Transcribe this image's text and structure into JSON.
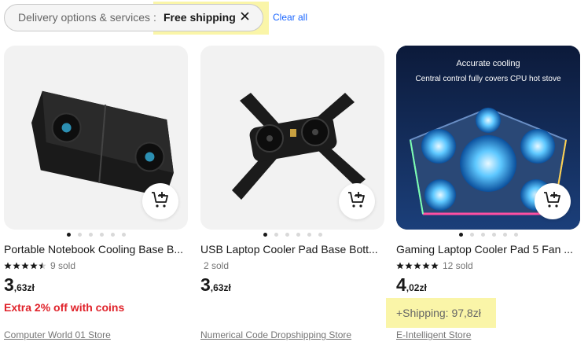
{
  "filter": {
    "label": "Delivery options & services :",
    "value": "Free shipping",
    "clear_label": "Clear all"
  },
  "products": [
    {
      "title": "Portable Notebook Cooling Base B...",
      "rating_stars": 4.5,
      "sold": "9 sold",
      "price_int": "3",
      "price_dec": ",63zł",
      "promo": "Extra 2% off with coins",
      "store": "Computer World 01 Store",
      "image_dots": 6,
      "active_dot": 0
    },
    {
      "title": "USB Laptop Cooler Pad Base Bott...",
      "sold": "2 sold",
      "price_int": "3",
      "price_dec": ",63zł",
      "store": "Numerical Code Dropshipping Store",
      "image_dots": 6,
      "active_dot": 0
    },
    {
      "title": "Gaming Laptop Cooler Pad 5 Fan ...",
      "rating_stars": 5,
      "sold": "12 sold",
      "price_int": "4",
      "price_dec": ",02zł",
      "shipping": "+Shipping: 97,8zł",
      "store": "E-Intelligent Store",
      "image_text_1": "Accurate cooling",
      "image_text_2": "Central control fully covers CPU hot stove",
      "image_dots": 6,
      "active_dot": 0
    }
  ],
  "colors": {
    "highlight": "#faf5a8",
    "promo_red": "#e0232b",
    "link_blue": "#1a66ff",
    "pill_bg": "#f5f5f5"
  },
  "icons": [
    "close-icon",
    "add-to-cart-icon",
    "star-icon"
  ]
}
